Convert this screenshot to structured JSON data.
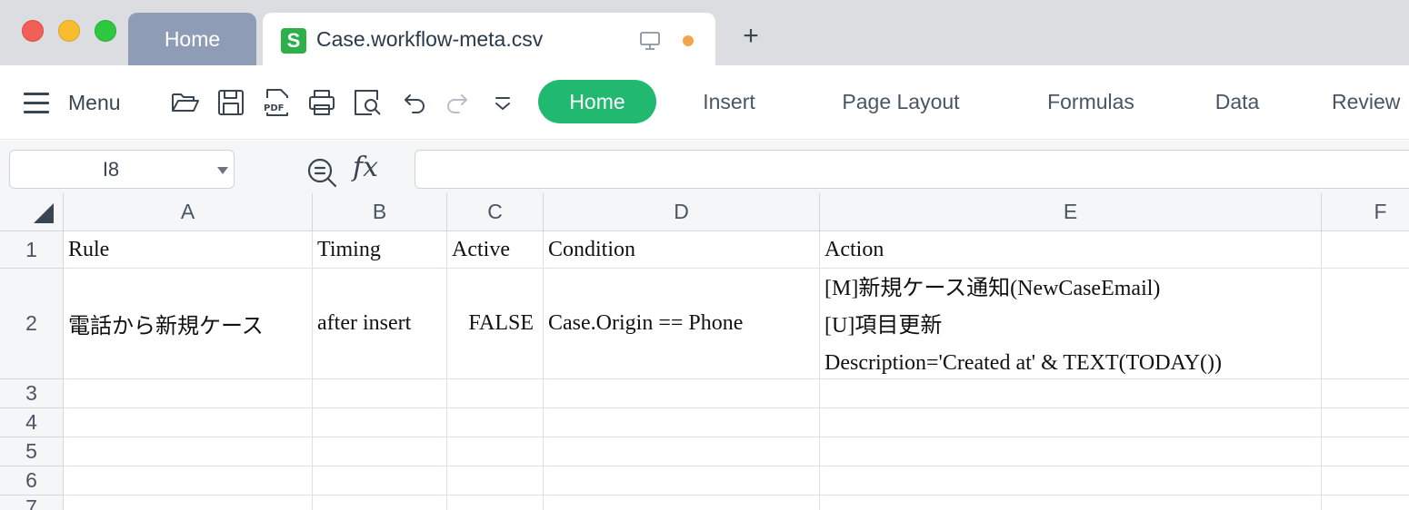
{
  "window": {
    "traffic_lights": [
      "close",
      "minimize",
      "maximize"
    ]
  },
  "tabs": {
    "home_label": "Home",
    "file_label": "Case.workflow-meta.csv",
    "file_icon_letter": "S",
    "new_tab_symbol": "+",
    "unsaved_dot_color": "#f2a54a"
  },
  "toolbar": {
    "menu_label": "Menu",
    "icons": [
      "folder-open-icon",
      "save-icon",
      "pdf-export-icon",
      "print-icon",
      "print-preview-icon",
      "undo-icon",
      "redo-icon",
      "more-dropdown-icon"
    ],
    "ribbon_tabs": [
      {
        "label": "Home",
        "active": true
      },
      {
        "label": "Insert",
        "active": false
      },
      {
        "label": "Page Layout",
        "active": false
      },
      {
        "label": "Formulas",
        "active": false
      },
      {
        "label": "Data",
        "active": false
      },
      {
        "label": "Review",
        "active": false
      }
    ],
    "accent_color": "#21b870"
  },
  "formula_bar": {
    "name_box_value": "I8",
    "fx_label": "fx",
    "formula_value": ""
  },
  "sheet": {
    "columns": [
      "A",
      "B",
      "C",
      "D",
      "E",
      "F"
    ],
    "rows": [
      "1",
      "2",
      "3",
      "4",
      "5",
      "6",
      "7"
    ],
    "cells": {
      "A1": "Rule",
      "B1": "Timing",
      "C1": "Active",
      "D1": "Condition",
      "E1": "Action",
      "A2": "電話から新規ケース",
      "B2": "after insert",
      "C2": "FALSE",
      "D2": "Case.Origin == Phone",
      "E2_lines": [
        "[M]新規ケース通知(NewCaseEmail)",
        "[U]項目更新",
        "Description='Created at' & TEXT(TODAY())"
      ]
    }
  }
}
